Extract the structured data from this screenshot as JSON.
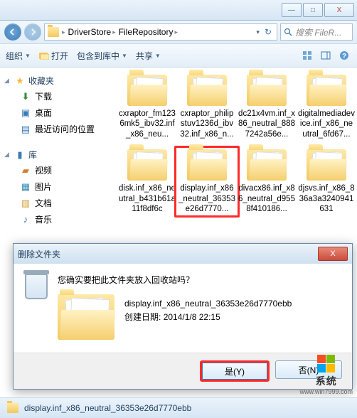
{
  "titlebar": {
    "min": "—",
    "max": "□",
    "close": "X"
  },
  "address": {
    "crumbs": [
      "DriverStore",
      "FileRepository"
    ],
    "search_placeholder": "搜索 FileR..."
  },
  "toolbar": {
    "organize": "组织",
    "open": "打开",
    "include": "包含到库中",
    "share": "共享"
  },
  "sidebar": {
    "favorites": {
      "label": "收藏夹",
      "items": [
        "下载",
        "桌面",
        "最近访问的位置"
      ]
    },
    "libraries": {
      "label": "库",
      "items": [
        "视频",
        "图片",
        "文档",
        "音乐"
      ]
    }
  },
  "folders": [
    "cxraptor_fm1236mk5_ibv32.inf_x86_neu...",
    "cxraptor_philipstuv1236d_ibv32.inf_x86_n...",
    "dc21x4vm.inf_x86_neutral_8887242a56e...",
    "digitalmediadevice.inf_x86_neutral_6fd67...",
    "disk.inf_x86_neutral_b431b61a11f8df6c",
    "display.inf_x86_neutral_36353e26d7770...",
    "divacx86.inf_x86_neutral_d9558f410186...",
    "djsvs.inf_x86_836a3a3240941631"
  ],
  "dialog": {
    "title": "删除文件夹",
    "question": "您确实要把此文件夹放入回收站吗？",
    "filename": "display.inf_x86_neutral_36353e26d7770ebb",
    "created_label": "创建日期:",
    "created_value": "2014/1/8 22:15",
    "yes": "是(Y)",
    "no": "否(N)"
  },
  "statusbar": {
    "text": "display.inf_x86_neutral_36353e26d7770ebb"
  },
  "watermark": {
    "brand": "系统",
    "url": "www.win7999.com"
  }
}
